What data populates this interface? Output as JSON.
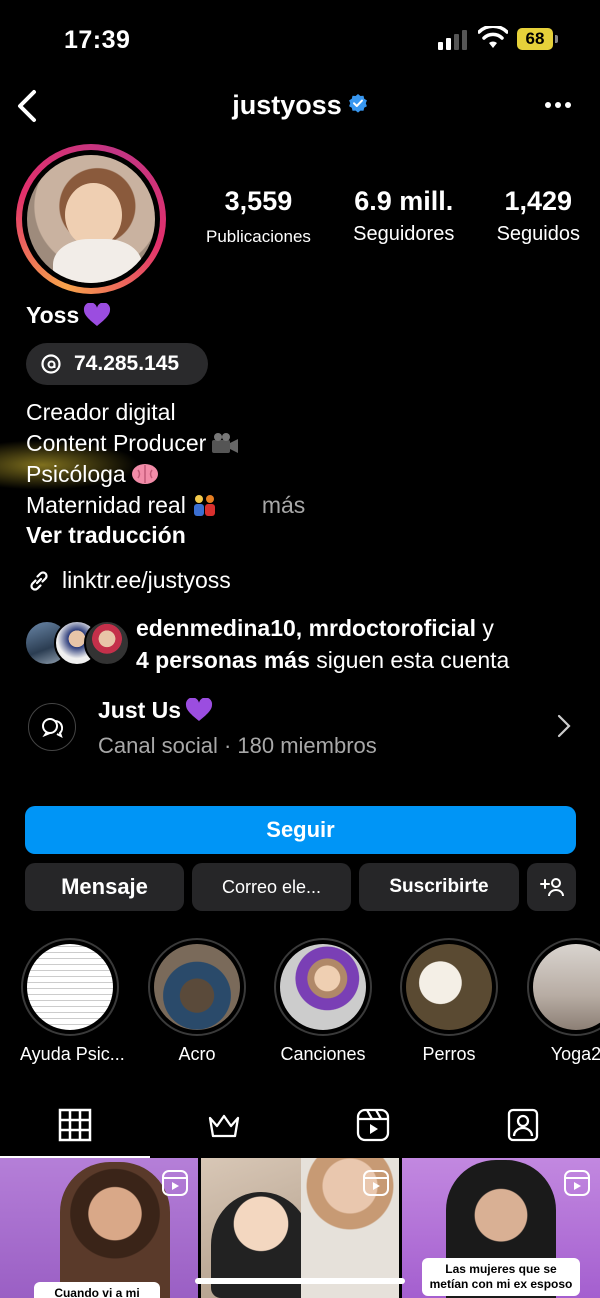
{
  "status_bar": {
    "time": "17:39",
    "battery": "68"
  },
  "header": {
    "username": "justyoss"
  },
  "stats": [
    {
      "value": "3,559",
      "label": "Publicaciones"
    },
    {
      "value": "6.9 mill.",
      "label": "Seguidores"
    },
    {
      "value": "1,429",
      "label": "Seguidos"
    }
  ],
  "profile": {
    "display_name": "Yoss",
    "threads_count": "74.285.145",
    "bio_lines": [
      "Creador digital",
      "Content Producer",
      "Psicóloga",
      "Maternidad real"
    ],
    "more": "más",
    "translate": "Ver traducción",
    "link": "linktr.ee/justyoss"
  },
  "followed_by": {
    "names": "edenmedina10, mrdoctoroficial",
    "and": " y",
    "more_bold": "4 personas más",
    "suffix": " siguen esta cuenta"
  },
  "channel": {
    "title": "Just Us",
    "subtitle": "Canal social · 180 miembros"
  },
  "buttons": {
    "follow": "Seguir",
    "message": "Mensaje",
    "email": "Correo ele...",
    "subscribe": "Suscribirte"
  },
  "highlights": [
    {
      "label": "Ayuda Psic..."
    },
    {
      "label": "Acro"
    },
    {
      "label": "Canciones"
    },
    {
      "label": "Perros"
    },
    {
      "label": "Yoga2"
    }
  ],
  "grid": [
    {
      "caption": "Cuando vi a mi papá"
    },
    {
      "caption": ""
    },
    {
      "caption": "Las mujeres que se metían con mi ex esposo"
    }
  ],
  "colors": {
    "accent": "#0095f6",
    "verified": "#3897f0",
    "heart": "#9b4de0"
  }
}
